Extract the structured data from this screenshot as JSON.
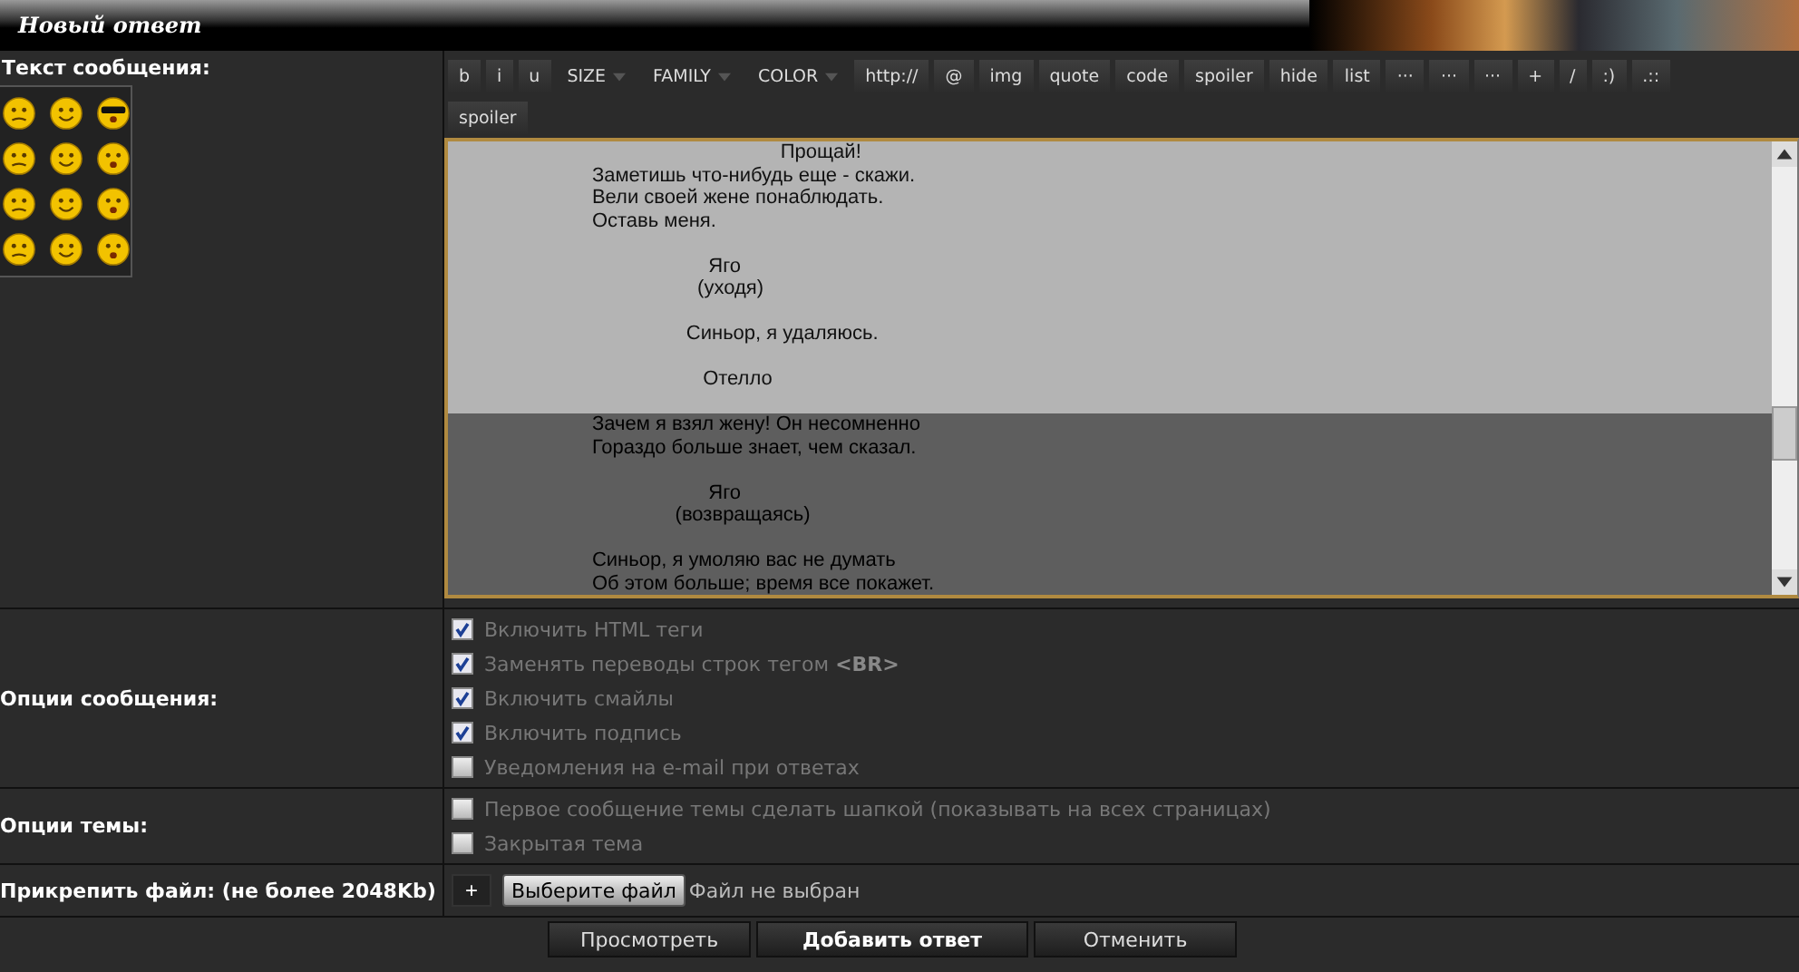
{
  "header": {
    "title": "Новый ответ"
  },
  "message": {
    "label": "Текст сообщения:",
    "toolbar": [
      {
        "kind": "button",
        "label": "b"
      },
      {
        "kind": "button",
        "label": "i"
      },
      {
        "kind": "button",
        "label": "u"
      },
      {
        "kind": "dropdown",
        "label": "SIZE"
      },
      {
        "kind": "dropdown",
        "label": "FAMILY"
      },
      {
        "kind": "dropdown",
        "label": "COLOR"
      },
      {
        "kind": "button",
        "label": "http://"
      },
      {
        "kind": "button",
        "label": "@"
      },
      {
        "kind": "button",
        "label": "img"
      },
      {
        "kind": "button",
        "label": "quote"
      },
      {
        "kind": "button",
        "label": "code"
      },
      {
        "kind": "button",
        "label": "spoiler"
      },
      {
        "kind": "button",
        "label": "hide"
      },
      {
        "kind": "button",
        "label": "list"
      },
      {
        "kind": "button",
        "label": "···"
      },
      {
        "kind": "button",
        "label": "···"
      },
      {
        "kind": "button",
        "label": "···"
      },
      {
        "kind": "button",
        "label": "+"
      },
      {
        "kind": "button",
        "label": "/"
      },
      {
        "kind": "button",
        "label": ":)"
      },
      {
        "kind": "button",
        "label": ".::"
      }
    ],
    "toolbar_row_2": [
      {
        "kind": "button",
        "label": "spoiler"
      }
    ],
    "blocks": [
      {
        "selected": true,
        "lines": [
          "                                                            Прощай!",
          "                          Заметишь что-нибудь еще - скажи.",
          "                          Вели своей жене понаблюдать.",
          "                          Оставь меня."
        ]
      },
      {
        "selected": true,
        "lines": [
          "                                               Яго",
          "                                             (уходя)"
        ]
      },
      {
        "selected": true,
        "lines": [
          "                                           Синьор, я удаляюсь."
        ]
      },
      {
        "selected": true,
        "lines": [
          "                                              Отелло"
        ]
      },
      {
        "selected": false,
        "lines": [
          "                          Зачем я взял жену! Он несомненно",
          "                          Гораздо больше знает, чем сказал."
        ]
      },
      {
        "selected": false,
        "lines": [
          "                                               Яго",
          "                                         (возвращаясь)"
        ]
      },
      {
        "selected": false,
        "lines": [
          "                          Синьор, я умоляю вас не думать",
          "                          Об этом больше; время все покажет."
        ]
      }
    ]
  },
  "post_options": {
    "label": "Опции сообщения:",
    "items": [
      {
        "label": "Включить HTML теги",
        "checked": true
      },
      {
        "label": "Заменять переводы строк тегом **<BR>**",
        "checked": true
      },
      {
        "label": "Включить смайлы",
        "checked": true
      },
      {
        "label": "Включить подпись",
        "checked": true
      },
      {
        "label": "Уведомления на e-mail при ответах",
        "checked": false
      }
    ]
  },
  "topic_options": {
    "label": "Опции темы:",
    "items": [
      {
        "label": "Первое сообщение темы сделать шапкой (показывать на всех страницах)",
        "checked": false
      },
      {
        "label": "Закрытая тема",
        "checked": false
      }
    ]
  },
  "attach": {
    "label": "Прикрепить файл: (не более 2048Kb)",
    "add": "+",
    "choose": "Выберите файл",
    "status": "Файл не выбран"
  },
  "buttons": [
    {
      "label": "Просмотреть",
      "primary": false
    },
    {
      "label": "Добавить ответ",
      "primary": true
    },
    {
      "label": "Отменить",
      "primary": false
    }
  ]
}
